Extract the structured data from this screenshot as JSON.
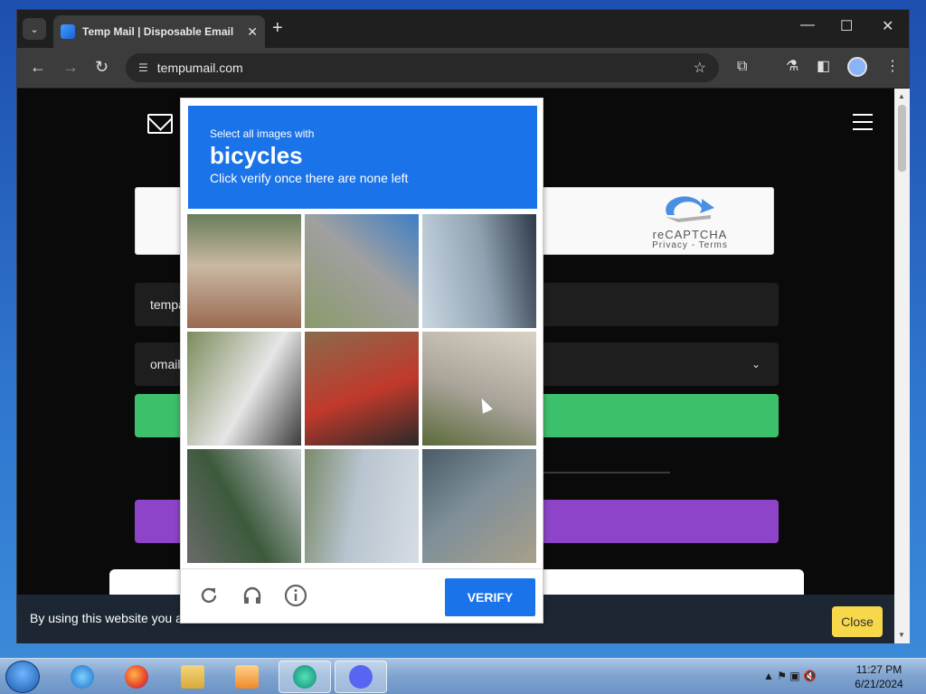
{
  "browser": {
    "tab_title": "Temp Mail | Disposable Email A",
    "tab_close": "✕",
    "new_tab": "+",
    "url": "tempumail.com",
    "window_min": "—",
    "window_max": "☐",
    "window_close": "✕"
  },
  "page": {
    "recaptcha_brand": "reCAPTCHA",
    "recaptcha_links": "Privacy - Terms",
    "email_field_partial": "tempa",
    "domain_field_partial": "omail",
    "cookie_text": "By using this website you a",
    "cookie_close": "Close"
  },
  "captcha": {
    "instruction_small": "Select all images with",
    "target_object": "bicycles",
    "instruction_sub": "Click verify once there are none left",
    "verify_label": "VERIFY",
    "tiles": [
      {
        "desc": "building-street",
        "colors": [
          "#9b6a50",
          "#c9b8a3",
          "#6a7d5b"
        ]
      },
      {
        "desc": "road-curve",
        "colors": [
          "#8a9a6a",
          "#a0a0a0",
          "#3e7fc6"
        ]
      },
      {
        "desc": "person-bicycle-sidewalk",
        "colors": [
          "#c9d7e2",
          "#8fa1b0",
          "#2f3a48"
        ]
      },
      {
        "desc": "bus",
        "colors": [
          "#7c8c5c",
          "#e6e6e6",
          "#3c3c3c"
        ]
      },
      {
        "desc": "person-red-bicycle",
        "colors": [
          "#8b6a4c",
          "#c0392b",
          "#2a2a2a"
        ]
      },
      {
        "desc": "person-bicycle-wall",
        "colors": [
          "#d9d3c7",
          "#a8a298",
          "#5a6a3a"
        ]
      },
      {
        "desc": "street-trees",
        "colors": [
          "#c9ccd0",
          "#3c5a3c",
          "#6a6a6a"
        ]
      },
      {
        "desc": "apartment-building",
        "colors": [
          "#d6dde3",
          "#b8c4cf",
          "#7a8a6a"
        ]
      },
      {
        "desc": "pavement-shadow",
        "colors": [
          "#a89f8a",
          "#7e8f9a",
          "#4a5a66"
        ]
      }
    ]
  },
  "taskbar": {
    "apps": [
      "ie-icon",
      "firefox-icon",
      "explorer-icon",
      "media-player-icon",
      "app-icon",
      "discord-icon"
    ],
    "time": "11:27 PM",
    "date": "6/21/2024"
  },
  "colors": {
    "captcha_blue": "#1a73e8",
    "green_button": "#3dc06c",
    "purple_button": "#8e44c8",
    "cookie_close": "#f7d84a"
  }
}
